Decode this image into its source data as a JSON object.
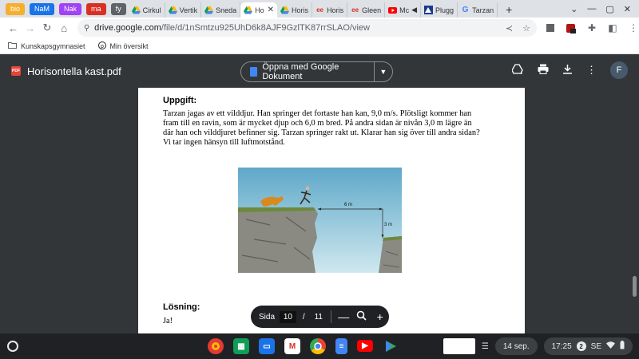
{
  "bookmark_chips": [
    {
      "label": "bio",
      "color": "#f6ae2d"
    },
    {
      "label": "NaM",
      "color": "#1a73e8"
    },
    {
      "label": "Nak",
      "color": "#a142f4"
    },
    {
      "label": "ma",
      "color": "#d93025"
    },
    {
      "label": "fy",
      "color": "#5f6368"
    }
  ],
  "tabs": [
    {
      "label": "Cirkul",
      "icon": "drive-icon"
    },
    {
      "label": "Vertik",
      "icon": "drive-icon"
    },
    {
      "label": "Sneda",
      "icon": "drive-icon"
    },
    {
      "label": "Ho",
      "icon": "drive-icon",
      "active": true
    },
    {
      "label": "Horis",
      "icon": "drive-icon"
    },
    {
      "label": "Horis",
      "icon": "ee-icon"
    },
    {
      "label": "Gleen",
      "icon": "ee-icon"
    },
    {
      "label": "Mc",
      "icon": "youtube-icon"
    },
    {
      "label": "Plugg",
      "icon": "pluggakuten-icon"
    },
    {
      "label": "Tarzan",
      "icon": "google-icon"
    }
  ],
  "omnibox": {
    "host": "drive.google.com",
    "path": "/file/d/1nSmtzu925UhD6k8AJF9GzlTK87rrSLAO/view"
  },
  "bookmarks": [
    {
      "label": "Kunskapsgymnasiet",
      "icon": "folder-icon"
    },
    {
      "label": "Min översikt",
      "icon": "pinterest-icon"
    }
  ],
  "pdf": {
    "title": "Horisontella kast.pdf",
    "open_with": "Öppna med Google Dokument",
    "avatar": "F"
  },
  "document": {
    "task_heading": "Uppgift:",
    "task_text": "Tarzan jagas av ett vilddjur. Han springer det fortaste han kan, 9,0 m/s. Plötsligt kommer han fram till en ravin, som är mycket djup och 6,0 m bred. På andra sidan är nivån 3,0 m lägre än där han och vilddjuret befinner sig. Tarzan springer rakt ut. Klarar han sig över till andra sidan? Vi tar ingen hänsyn till luftmotstånd.",
    "figure": {
      "width_label": "6 m",
      "height_label": "3 m"
    },
    "solution_heading": "Lösning:",
    "answer": "Ja!"
  },
  "page_control": {
    "label": "Sida",
    "current": "10",
    "separator": "/",
    "total": "11"
  },
  "shelf": {
    "apps": [
      {
        "name": "photos",
        "color": "#e53935"
      },
      {
        "name": "classroom",
        "color": "#0f9d58"
      },
      {
        "name": "files",
        "color": "#1a73e8"
      },
      {
        "name": "gmail",
        "color": "#ffffff"
      },
      {
        "name": "chrome",
        "color": "#4285f4"
      },
      {
        "name": "docs",
        "color": "#4285f4"
      },
      {
        "name": "youtube",
        "color": "#ff0000"
      },
      {
        "name": "play",
        "color": "#34a853"
      }
    ],
    "date": "14 sep.",
    "time": "17:25",
    "notifications": "2",
    "locale": "SE"
  }
}
